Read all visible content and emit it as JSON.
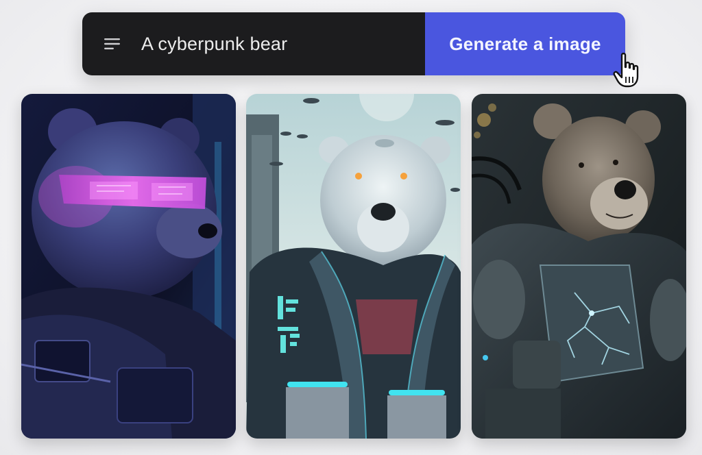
{
  "prompt": {
    "menu_icon": "menu-lines-icon",
    "text": "A cyberpunk bear"
  },
  "action": {
    "generate_label": "Generate a image",
    "cursor_icon": "hand-pointer-icon"
  },
  "colors": {
    "bar_dark": "#1c1c1e",
    "button_accent": "#4a56df",
    "page_bg": "#f1f1f3"
  },
  "results": [
    {
      "name": "bear-with-pink-visor",
      "palette": [
        "#0f1330",
        "#3d2a6e",
        "#d24fd6"
      ]
    },
    {
      "name": "polar-bear-in-jacket",
      "palette": [
        "#cfe3e4",
        "#2a3a45",
        "#41e3f0"
      ]
    },
    {
      "name": "armored-brown-bear",
      "palette": [
        "#1c2124",
        "#6c6358",
        "#aee4f1"
      ]
    }
  ]
}
